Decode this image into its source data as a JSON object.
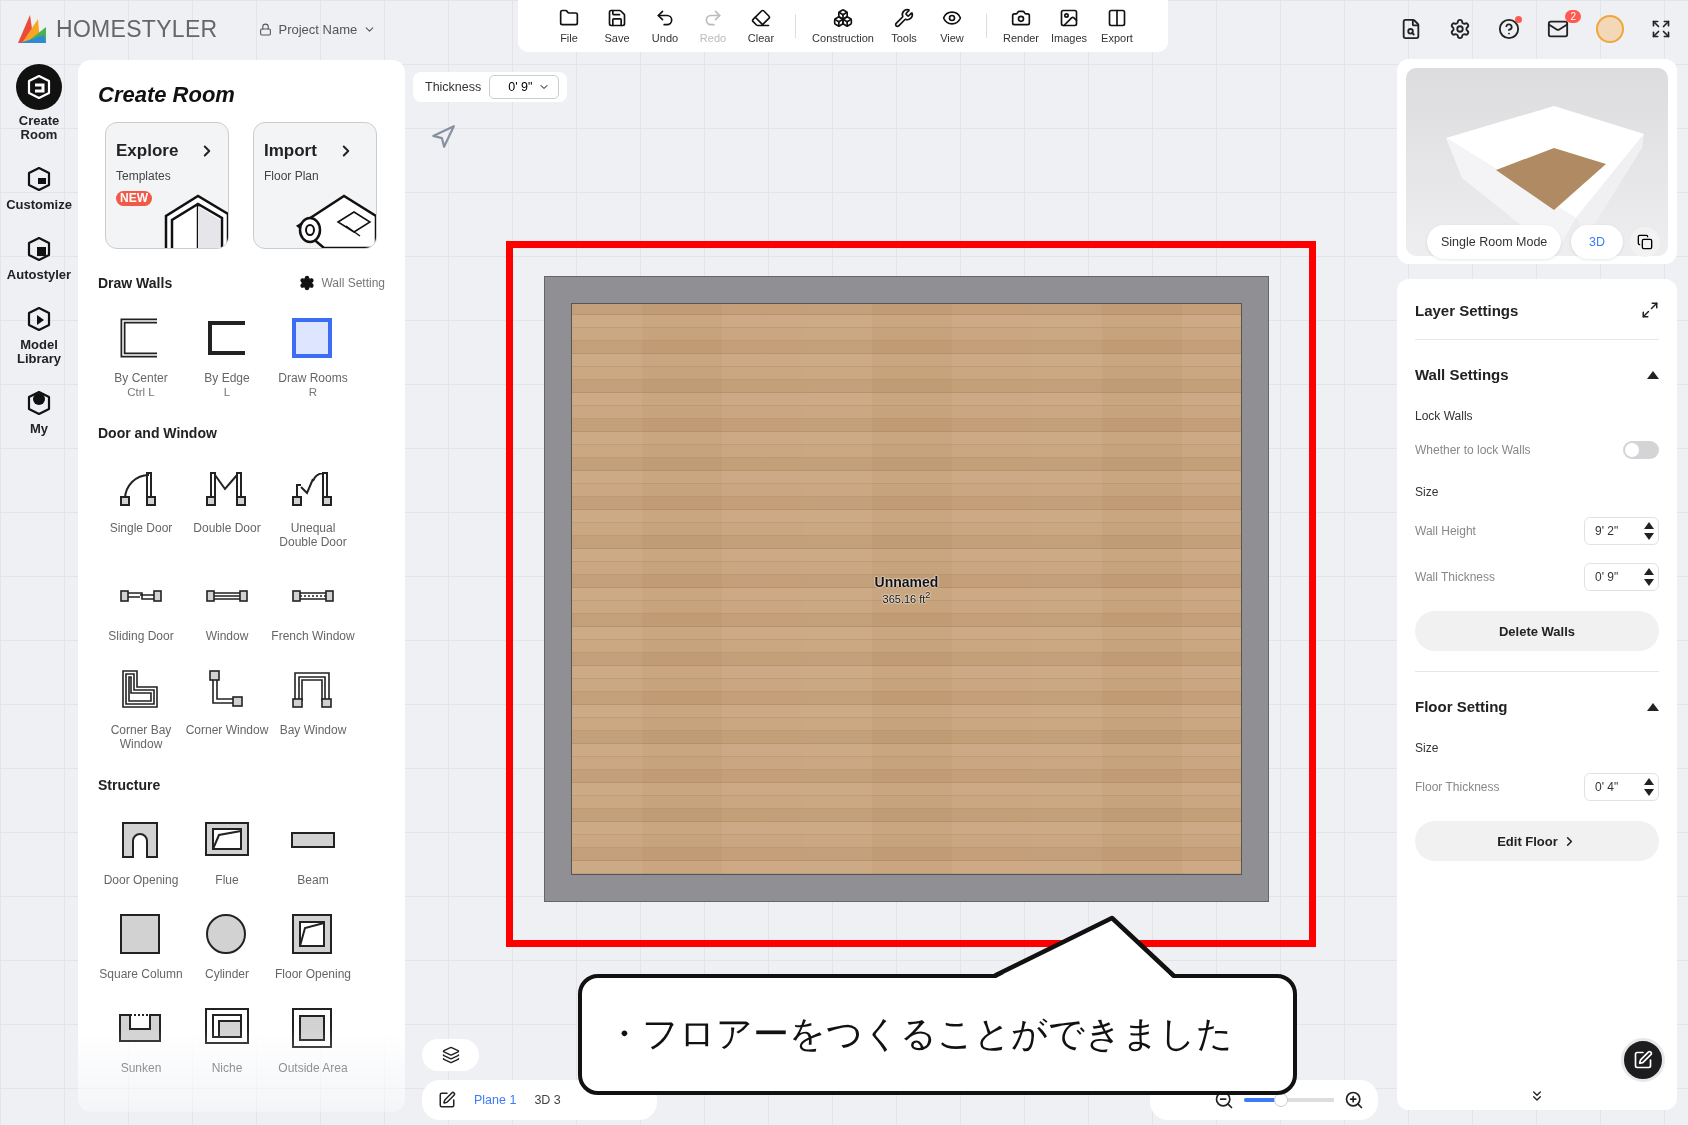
{
  "header": {
    "brand": "HOMESTYLER",
    "project_name": "Project Name"
  },
  "toolbar_groups": [
    {
      "items": [
        {
          "kind": "file",
          "label": "File",
          "disabled": false
        },
        {
          "kind": "save",
          "label": "Save",
          "disabled": false
        },
        {
          "kind": "undo",
          "label": "Undo",
          "disabled": false
        },
        {
          "kind": "redo",
          "label": "Redo",
          "disabled": true
        },
        {
          "kind": "clear",
          "label": "Clear",
          "disabled": false
        }
      ]
    },
    {
      "items": [
        {
          "kind": "construction",
          "label": "Construction",
          "disabled": false
        },
        {
          "kind": "tools",
          "label": "Tools",
          "disabled": false
        },
        {
          "kind": "view",
          "label": "View",
          "disabled": false
        }
      ]
    },
    {
      "items": [
        {
          "kind": "render",
          "label": "Render",
          "disabled": false
        },
        {
          "kind": "images",
          "label": "Images",
          "disabled": false
        },
        {
          "kind": "export",
          "label": "Export",
          "disabled": false
        }
      ]
    }
  ],
  "notifications": {
    "mail_count": "2"
  },
  "rail": [
    {
      "kind": "create-room",
      "label": "Create Room",
      "selected": true
    },
    {
      "kind": "customize",
      "label": "Customize",
      "selected": false
    },
    {
      "kind": "autostyler",
      "label": "Autostyler",
      "selected": false
    },
    {
      "kind": "model-library",
      "label": "Model Library",
      "selected": false
    },
    {
      "kind": "my",
      "label": "My",
      "selected": false
    }
  ],
  "panel": {
    "title": "Create Room",
    "cards": [
      {
        "kind": "templates",
        "title": "Explore",
        "subtitle": "Templates",
        "badge": "NEW"
      },
      {
        "kind": "floor-plan",
        "title": "Import",
        "subtitle": "Floor Plan"
      }
    ],
    "sections": [
      {
        "title": "Draw Walls",
        "action": "Wall Setting",
        "items": [
          {
            "kind": "by-center",
            "label": "By Center",
            "shortcut": "Ctrl L"
          },
          {
            "kind": "by-edge",
            "label": "By Edge",
            "shortcut": "L"
          },
          {
            "kind": "draw-rooms",
            "label": "Draw Rooms",
            "shortcut": "R"
          }
        ]
      },
      {
        "title": "Door and Window",
        "items": [
          {
            "kind": "single-door",
            "label": "Single Door"
          },
          {
            "kind": "double-door",
            "label": "Double Door"
          },
          {
            "kind": "unequal-door",
            "label": "Unequal Double Door"
          },
          {
            "kind": "sliding-door",
            "label": "Sliding Door"
          },
          {
            "kind": "window",
            "label": "Window"
          },
          {
            "kind": "french-window",
            "label": "French Window"
          },
          {
            "kind": "corner-bay",
            "label": "Corner Bay Window"
          },
          {
            "kind": "corner-window",
            "label": "Corner Window"
          },
          {
            "kind": "bay-window",
            "label": "Bay Window"
          }
        ]
      },
      {
        "title": "Structure",
        "items": [
          {
            "kind": "door-opening",
            "label": "Door Opening"
          },
          {
            "kind": "flue",
            "label": "Flue"
          },
          {
            "kind": "beam",
            "label": "Beam"
          },
          {
            "kind": "square-column",
            "label": "Square Column"
          },
          {
            "kind": "cylinder",
            "label": "Cylinder"
          },
          {
            "kind": "floor-opening",
            "label": "Floor Opening"
          },
          {
            "kind": "sunken",
            "label": "Sunken"
          },
          {
            "kind": "niche",
            "label": "Niche"
          },
          {
            "kind": "outside-area",
            "label": "Outside Area"
          }
        ]
      }
    ]
  },
  "canvas": {
    "thickness_label": "Thickness",
    "thickness_value": "0' 9\"",
    "room": {
      "name": "Unnamed",
      "area": "365.16 ft$^{2}$"
    },
    "callout": "・フロアーをつくることができました",
    "bottom_bar": {
      "plane": "Plane 1",
      "view": "3D 3"
    },
    "zoom": {
      "level": 0.4
    }
  },
  "preview": {
    "mode_button": "Single Room Mode",
    "view_button": "3D"
  },
  "layer_settings": {
    "title": "Layer Settings",
    "sections": [
      {
        "title": "Wall Settings",
        "expanded": true,
        "rows": [
          {
            "kind": "heading",
            "label": "Lock Walls"
          },
          {
            "kind": "toggle",
            "label": "Whether to lock Walls",
            "on": false
          },
          {
            "kind": "heading",
            "label": "Size"
          },
          {
            "kind": "stepper",
            "label": "Wall Height",
            "value": "9' 2\""
          },
          {
            "kind": "stepper",
            "label": "Wall Thickness",
            "value": "0' 9\""
          },
          {
            "kind": "button",
            "label": "Delete Walls"
          }
        ]
      },
      {
        "title": "Floor Setting",
        "expanded": true,
        "rows": [
          {
            "kind": "heading",
            "label": "Size"
          },
          {
            "kind": "stepper",
            "label": "Floor Thickness",
            "value": "0' 4\""
          },
          {
            "kind": "button",
            "label": "Edit Floor",
            "chevron": true
          }
        ]
      }
    ]
  }
}
